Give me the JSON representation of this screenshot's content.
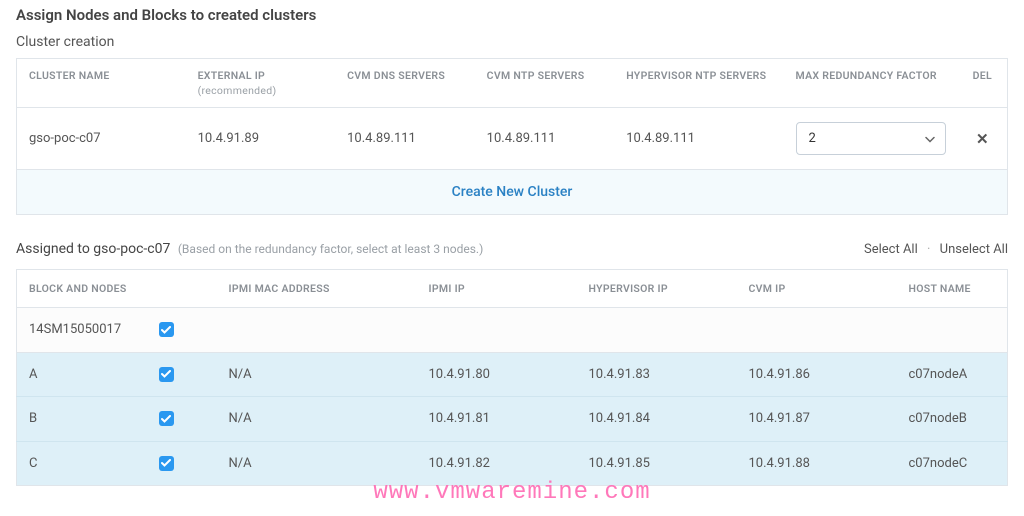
{
  "titles": {
    "page": "Assign Nodes and Blocks to created clusters",
    "cluster_creation": "Cluster creation"
  },
  "cluster_table": {
    "headers": {
      "name": "CLUSTER NAME",
      "ext_ip": "EXTERNAL IP",
      "ext_ip_sub": "(recommended)",
      "cvm_dns": "CVM DNS SERVERS",
      "cvm_ntp": "CVM NTP SERVERS",
      "hyp_ntp": "HYPERVISOR NTP SERVERS",
      "max_red": "MAX REDUNDANCY FACTOR",
      "del": "DEL"
    },
    "row": {
      "name": "gso-poc-c07",
      "ext_ip": "10.4.91.89",
      "cvm_dns": "10.4.89.111",
      "cvm_ntp": "10.4.89.111",
      "hyp_ntp": "10.4.89.111",
      "max_red": "2"
    },
    "create_label": "Create New Cluster"
  },
  "assigned": {
    "prefix": "Assigned to ",
    "cluster": "gso-poc-c07",
    "hint": "(Based on the redundancy factor, select at least 3 nodes.)",
    "select_all": "Select All",
    "unselect_all": "Unselect All"
  },
  "nodes_table": {
    "headers": {
      "block": "BLOCK AND NODES",
      "ipmi_mac": "IPMI MAC ADDRESS",
      "ipmi_ip": "IPMI IP",
      "hyp_ip": "HYPERVISOR IP",
      "cvm_ip": "CVM IP",
      "host": "HOST NAME"
    },
    "block_id": "14SM15050017",
    "rows": [
      {
        "letter": "A",
        "ipmi_mac": "N/A",
        "ipmi_ip": "10.4.91.80",
        "hyp_ip": "10.4.91.83",
        "cvm_ip": "10.4.91.86",
        "host": "c07nodeA"
      },
      {
        "letter": "B",
        "ipmi_mac": "N/A",
        "ipmi_ip": "10.4.91.81",
        "hyp_ip": "10.4.91.84",
        "cvm_ip": "10.4.91.87",
        "host": "c07nodeB"
      },
      {
        "letter": "C",
        "ipmi_mac": "N/A",
        "ipmi_ip": "10.4.91.82",
        "hyp_ip": "10.4.91.85",
        "cvm_ip": "10.4.91.88",
        "host": "c07nodeC"
      }
    ]
  },
  "watermark": "www.vmwaremine.com"
}
